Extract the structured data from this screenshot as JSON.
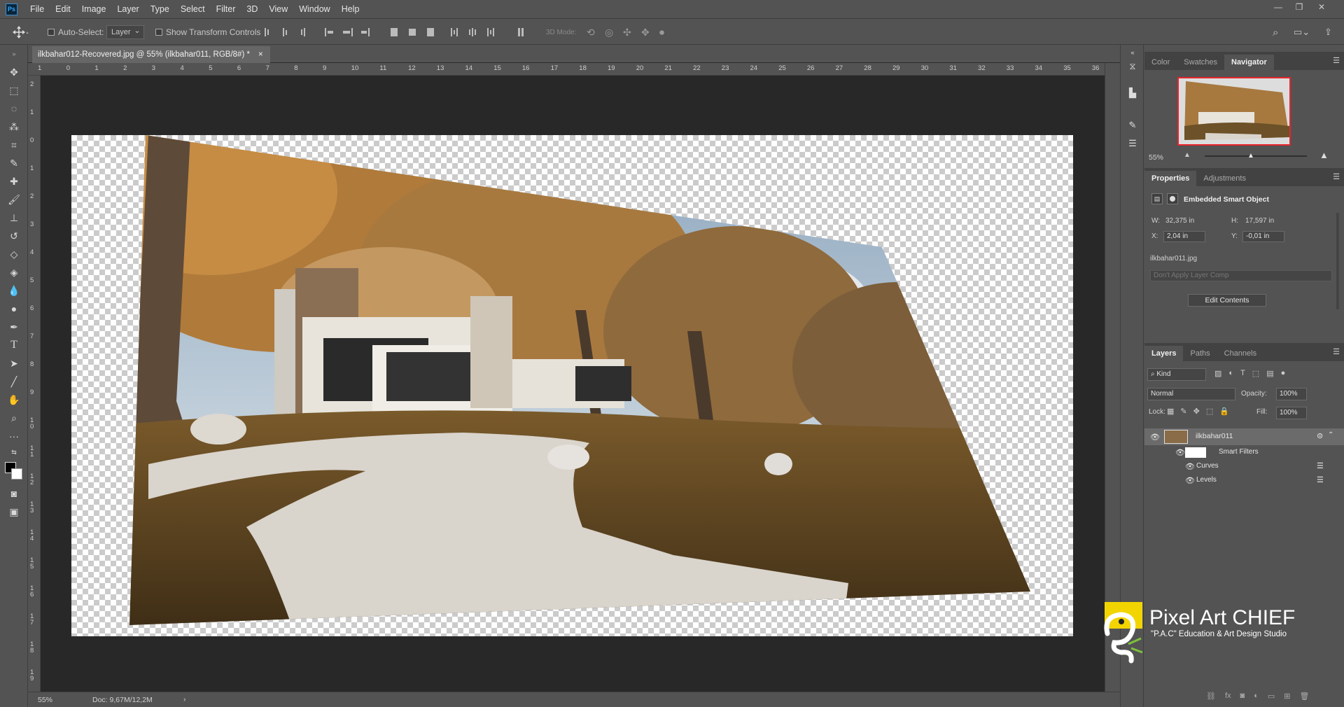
{
  "app": {
    "logo_text": "Ps"
  },
  "menu": [
    "File",
    "Edit",
    "Image",
    "Layer",
    "Type",
    "Select",
    "Filter",
    "3D",
    "View",
    "Window",
    "Help"
  ],
  "options_bar": {
    "auto_select_label": "Auto-Select:",
    "auto_select_value": "Layer",
    "show_transform_label": "Show Transform Controls",
    "mode_3d_label": "3D Mode:"
  },
  "document": {
    "tab_title": "ilkbahar012-Recovered.jpg @ 55% (ilkbahar011, RGB/8#) *",
    "close_glyph": "×"
  },
  "rulers": {
    "horizontal": [
      "1",
      "0",
      "1",
      "2",
      "3",
      "4",
      "5",
      "6",
      "7",
      "8",
      "9",
      "10",
      "11",
      "12",
      "13",
      "14",
      "15",
      "16",
      "17",
      "18",
      "19",
      "20",
      "21",
      "22",
      "23",
      "24",
      "25",
      "26",
      "27",
      "28",
      "29",
      "30",
      "31",
      "32",
      "33",
      "34",
      "35",
      "36"
    ],
    "vertical": [
      "2",
      "1",
      "0",
      "1",
      "2",
      "3",
      "4",
      "5",
      "6",
      "7",
      "8",
      "9",
      "1 0",
      "1 1",
      "1 2",
      "1 3",
      "1 4",
      "1 5",
      "1 6",
      "1 7",
      "1 8",
      "1 9"
    ]
  },
  "status": {
    "zoom": "55%",
    "doc": "Doc: 9,67M/12,2M"
  },
  "navigator": {
    "tabs": [
      "Color",
      "Swatches",
      "Navigator"
    ],
    "active_tab": "Navigator",
    "zoom": "55%"
  },
  "properties": {
    "tabs": [
      "Properties",
      "Adjustments"
    ],
    "active_tab": "Properties",
    "type_label": "Embedded Smart Object",
    "w_label": "W:",
    "w_value": "32,375 in",
    "h_label": "H:",
    "h_value": "17,597 in",
    "x_label": "X:",
    "x_value": "2,04 in",
    "y_label": "Y:",
    "y_value": "-0,01 in",
    "filename": "ilkbahar011.jpg",
    "layer_comp_placeholder": "Don't Apply Layer Comp",
    "edit_contents_label": "Edit Contents"
  },
  "layers": {
    "tabs": [
      "Layers",
      "Paths",
      "Channels"
    ],
    "active_tab": "Layers",
    "kind_label": "Kind",
    "blend_mode": "Normal",
    "opacity_label": "Opacity:",
    "opacity_value": "100%",
    "lock_label": "Lock:",
    "fill_label": "Fill:",
    "fill_value": "100%",
    "items": [
      {
        "name": "ilkbahar011"
      },
      {
        "name": "Smart Filters"
      },
      {
        "name": "Curves"
      },
      {
        "name": "Levels"
      }
    ]
  },
  "watermark": {
    "title": "Pixel Art CHIEF",
    "subtitle": "\"P.A.C\" Education & Art Design Studio"
  },
  "colors": {
    "ui_bg": "#535353",
    "canvas_bg": "#282828",
    "accent_red": "#e8242b",
    "watermark_yellow": "#f2d500"
  }
}
